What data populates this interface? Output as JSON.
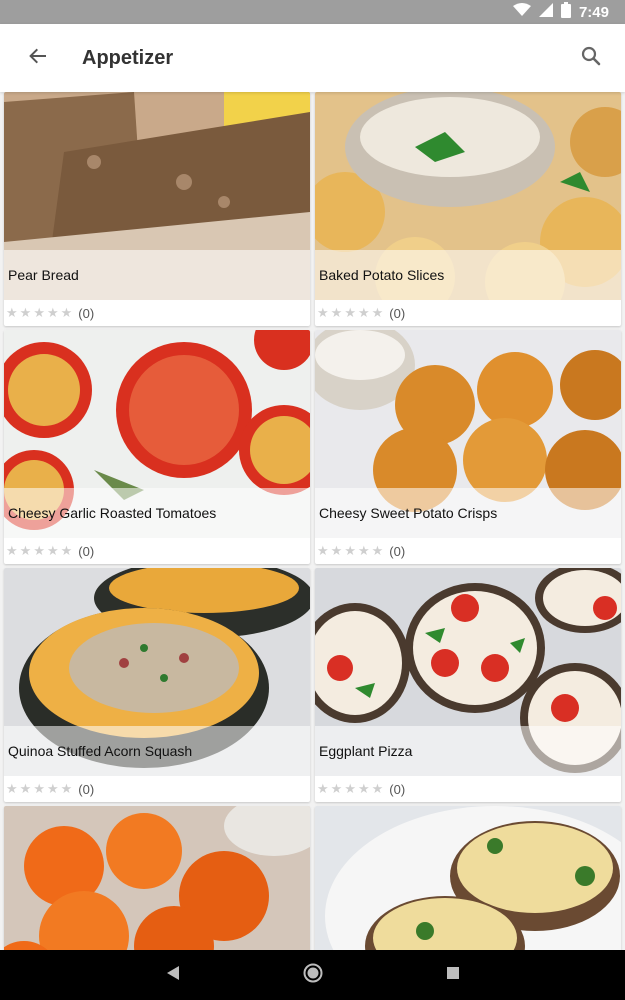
{
  "status_bar": {
    "time": "7:49"
  },
  "app_bar": {
    "title": "Appetizer"
  },
  "recipes": [
    {
      "name": "Pear Bread",
      "rating_count": "(0)"
    },
    {
      "name": "Baked Potato Slices",
      "rating_count": "(0)"
    },
    {
      "name": "Cheesy Garlic Roasted Tomatoes",
      "rating_count": "(0)"
    },
    {
      "name": "Cheesy Sweet Potato Crisps",
      "rating_count": "(0)"
    },
    {
      "name": "Quinoa Stuffed Acorn Squash",
      "rating_count": "(0)"
    },
    {
      "name": "Eggplant Pizza",
      "rating_count": "(0)"
    },
    {
      "name": "",
      "rating_count": ""
    },
    {
      "name": "",
      "rating_count": ""
    }
  ],
  "colors": {
    "status_bar": "#9e9e9e",
    "app_bar": "#ffffff",
    "background": "#f2f2f2",
    "nav_bar": "#000000",
    "star_empty": "#cfcfcf"
  },
  "icons": [
    "back-arrow-icon",
    "search-icon",
    "wifi-icon",
    "signal-icon",
    "battery-icon",
    "nav-back-icon",
    "nav-home-icon",
    "nav-recents-icon",
    "star-icon"
  ]
}
